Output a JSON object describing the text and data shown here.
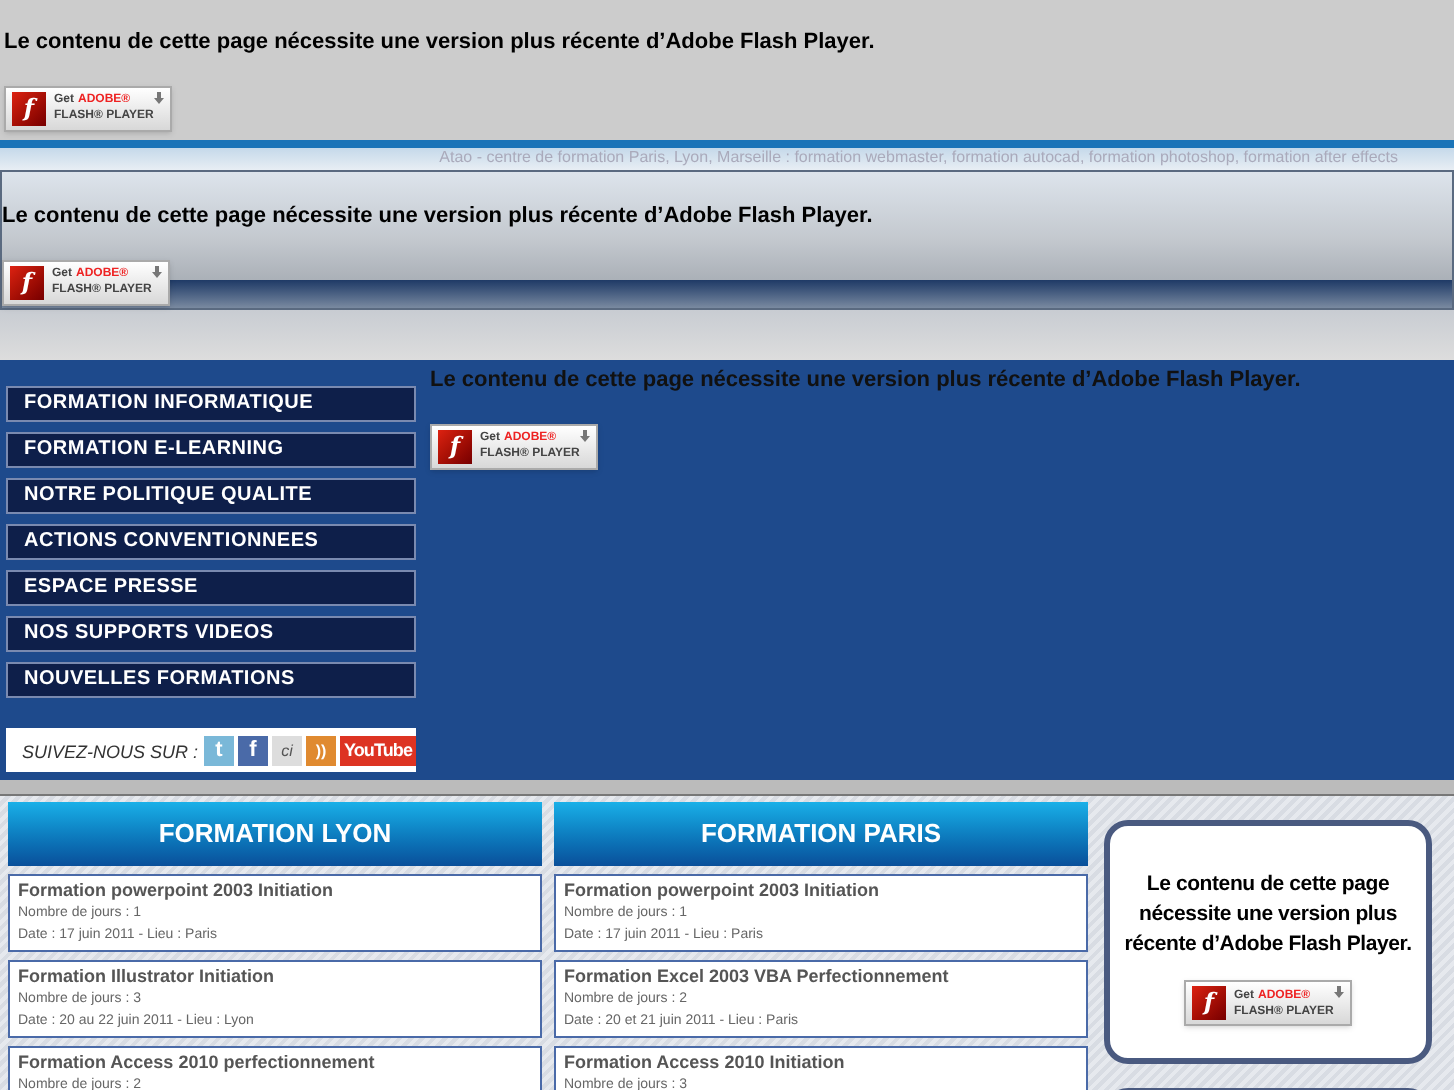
{
  "top_flash": {
    "message": "Le contenu de cette page nécessite une version plus récente d’Adobe Flash Player.",
    "badge": {
      "logo": "f",
      "get": "Get",
      "brand": "ADOBE®",
      "product": "FLASH® PLAYER"
    }
  },
  "tagline": "Atao - centre de formation Paris, Lyon, Marseille : formation webmaster, formation autocad, formation photoshop, formation after effects",
  "header_flash": {
    "message": "Le contenu de cette page nécessite une version plus récente d’Adobe Flash Player.",
    "badge": {
      "logo": "f",
      "get": "Get",
      "brand": "ADOBE®",
      "product": "FLASH® PLAYER"
    }
  },
  "menu": [
    "FORMATION INFORMATIQUE",
    "FORMATION E-LEARNING",
    "NOTRE POLITIQUE QUALITE",
    "ACTIONS CONVENTIONNEES",
    "ESPACE PRESSE",
    "NOS SUPPORTS VIDEOS",
    "NOUVELLES FORMATIONS"
  ],
  "social": {
    "label": "SUIVEZ-NOUS SUR :",
    "icons": [
      {
        "kind": "twitter",
        "text": "t"
      },
      {
        "kind": "facebook",
        "text": "f"
      },
      {
        "kind": "other",
        "text": "ci"
      },
      {
        "kind": "rss",
        "text": "))"
      },
      {
        "kind": "youtube",
        "text": "YouTube"
      }
    ]
  },
  "main_flash": {
    "message": "Le contenu de cette page nécessite une version plus récente d’Adobe Flash Player.",
    "badge": {
      "logo": "f",
      "get": "Get",
      "brand": "ADOBE®",
      "product": "FLASH® PLAYER"
    }
  },
  "columns": [
    {
      "title": "FORMATION LYON",
      "courses": [
        {
          "title": "Formation powerpoint 2003 Initiation",
          "days": "Nombre de jours : 1",
          "date": "Date : 17 juin 2011 - Lieu : Paris"
        },
        {
          "title": "Formation Illustrator Initiation",
          "days": "Nombre de jours : 3",
          "date": "Date : 20 au 22 juin 2011 - Lieu : Lyon"
        },
        {
          "title": "Formation Access 2010 perfectionnement",
          "days": "Nombre de jours : 2"
        }
      ]
    },
    {
      "title": "FORMATION PARIS",
      "courses": [
        {
          "title": "Formation powerpoint 2003 Initiation",
          "days": "Nombre de jours : 1",
          "date": "Date : 17 juin 2011 - Lieu : Paris"
        },
        {
          "title": "Formation Excel 2003 VBA Perfectionnement",
          "days": "Nombre de jours : 2",
          "date": "Date : 20 et 21 juin 2011 - Lieu : Paris"
        },
        {
          "title": "Formation Access 2010 Initiation",
          "days": "Nombre de jours : 3"
        }
      ]
    }
  ],
  "side_flash": {
    "message": "Le contenu de cette page nécessite une version plus récente d’Adobe Flash Player.",
    "badge": {
      "logo": "f",
      "get": "Get",
      "brand": "ADOBE®",
      "product": "FLASH® PLAYER"
    }
  }
}
